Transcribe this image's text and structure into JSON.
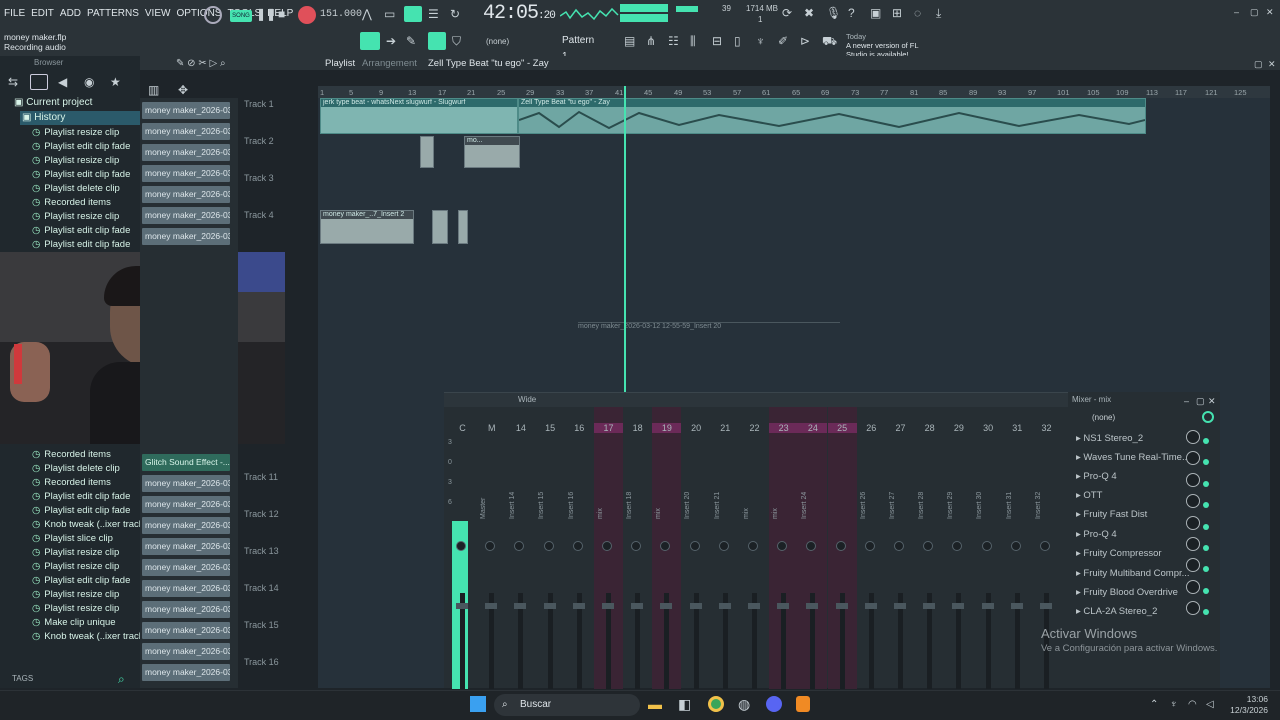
{
  "app": {
    "project_file": "money maker.flp",
    "status": "Recording audio",
    "menu": [
      "FILE",
      "EDIT",
      "ADD",
      "PATTERNS",
      "VIEW",
      "OPTIONS",
      "TOOLS",
      "HELP"
    ],
    "tempo": "151.000",
    "song_mode": "SONG",
    "time": "42:05",
    "time_sub": ":20",
    "cpu": "39",
    "memory": "1714 MB",
    "mem_sub": "1",
    "snap": "(none)",
    "pattern": "Pattern 1",
    "news_date": "Today",
    "news_text": "A newer version of FL Studio is available!"
  },
  "browser": {
    "title": "Browser",
    "current_project": "Current project",
    "history": "History",
    "items_top": [
      "Playlist resize clip",
      "Playlist edit clip fade",
      "Playlist resize clip",
      "Playlist edit clip fade",
      "Playlist delete clip",
      "Recorded items",
      "Playlist resize clip",
      "Playlist edit clip fade",
      "Playlist edit clip fade"
    ],
    "items_bottom": [
      "Recorded items",
      "Playlist delete clip",
      "Recorded items",
      "Playlist edit clip fade",
      "Playlist edit clip fade",
      "Knob tweak (..ixer track)",
      "Playlist slice clip",
      "Playlist resize clip",
      "Playlist resize clip",
      "Playlist edit clip fade",
      "Playlist resize clip",
      "Playlist resize clip",
      "Make clip unique",
      "Knob tweak (..ixer track)"
    ],
    "tags": "TAGS"
  },
  "clips_panel": {
    "top": [
      "money maker_2026-03-...",
      "money maker_2026-03-...",
      "money maker_2026-03-...",
      "money maker_2026-03-...",
      "money maker_2026-03-...",
      "money maker_2026-03-...",
      "money maker_2026-03-..."
    ],
    "active": "Glitch Sound Effect -...",
    "bottom": [
      "money maker_2026-03-...",
      "money maker_2026-03-...",
      "money maker_2026-03-...",
      "money maker_2026-03-...",
      "money maker_2026-03-...",
      "money maker_2026-03-...",
      "money maker_2026-03-...",
      "money maker_2026-03-...",
      "money maker_2026-03-...",
      "money maker_2026-03-..."
    ]
  },
  "playlist": {
    "title": "Playlist",
    "sub": "Arrangement",
    "breadcrumb": "Zell Type Beat \"tu ego\" - Zay",
    "ruler": [
      "1",
      "5",
      "9",
      "13",
      "17",
      "21",
      "25",
      "29",
      "33",
      "37",
      "41",
      "45",
      "49",
      "53",
      "57",
      "61",
      "65",
      "69",
      "73",
      "77",
      "81",
      "85",
      "89",
      "93",
      "97",
      "101",
      "105",
      "109",
      "113",
      "117",
      "121",
      "125"
    ],
    "tracks_top": [
      "Track 1",
      "Track 2",
      "Track 3",
      "Track 4"
    ],
    "tracks_bottom": [
      "Track 11",
      "Track 12",
      "Track 13",
      "Track 14",
      "Track 15",
      "Track 16"
    ],
    "clip_labels": {
      "c1": "jerk type beat - whatsNext slugwurf - Slugwurf",
      "c2": "Zell Type Beat \"tu ego\" - Zay",
      "c3": "mo...",
      "c4": "money maker_..7_Insert 2",
      "c5": "money maker_2026-03-12 12-55-59_Insert 20"
    }
  },
  "mixer": {
    "title": "Wide",
    "panel_title": "Mixer - mix",
    "db_marks": [
      "3",
      "0",
      "3",
      "6"
    ],
    "cols": [
      "C",
      "M",
      "14",
      "15",
      "16",
      "17",
      "18",
      "19",
      "20",
      "21",
      "22",
      "23",
      "24",
      "25",
      "26",
      "27",
      "28",
      "29",
      "30",
      "31",
      "32"
    ],
    "labels": [
      "Master",
      "Insert 14",
      "Insert 15",
      "Insert 16",
      "mix",
      "Insert 18",
      "mix",
      "Insert 20",
      "Insert 21",
      "mix",
      "mix",
      "Insert 24",
      "Insert 26",
      "Insert 27",
      "Insert 28",
      "Insert 29",
      "Insert 30",
      "Insert 31",
      "Insert 32"
    ],
    "preset": "(none)",
    "fx": [
      "NS1 Stereo_2",
      "Waves Tune Real-Time...",
      "Pro-Q 4",
      "OTT",
      "Fruity Fast Dist",
      "Pro-Q 4",
      "Fruity Compressor",
      "Fruity Multiband Compr...",
      "Fruity Blood Overdrive",
      "CLA-2A Stereo_2"
    ]
  },
  "watermark": {
    "line1": "Activar Windows",
    "line2": "Ve a Configuración para activar Windows."
  },
  "taskbar": {
    "search": "Buscar",
    "clock_time": "13:06",
    "clock_date": "12/3/2026"
  }
}
